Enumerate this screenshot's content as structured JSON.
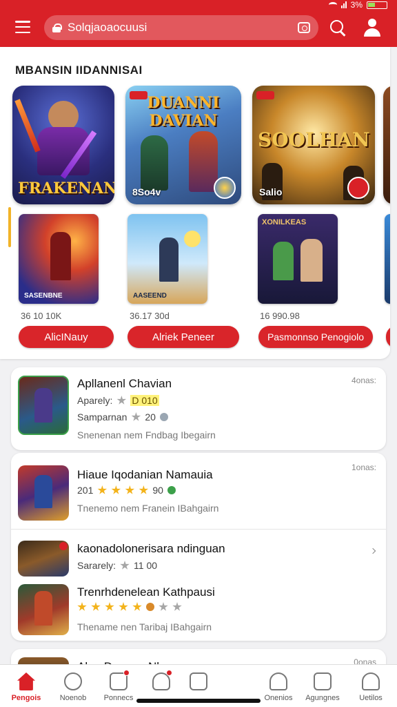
{
  "status": {
    "signal": "3%"
  },
  "header": {
    "search_placeholder": "Solqjaoaocuusi"
  },
  "featured": {
    "title": "MBANSIN IIDANNISAI",
    "big_cards": [
      {
        "title": "FRAKENAN",
        "stat": ""
      },
      {
        "title": "DUANNI DAVIAN",
        "stat": "8So4v"
      },
      {
        "title": "SOOLHAN",
        "stat": "Salio"
      }
    ],
    "small_cards": [
      {
        "label": "SASENBNE",
        "top": "",
        "count": "36 10 10K",
        "button": "AlicINauy"
      },
      {
        "label": "AASEEND",
        "top": "",
        "count": "36.17 30d",
        "button": "Alriek Peneer"
      },
      {
        "label": "",
        "top": "XONILKEAS",
        "count": "16 990.98",
        "button": "Pasmonnso Penogiolo"
      }
    ]
  },
  "list": [
    {
      "title": "Apllanenl Chavian",
      "time": "4onas:",
      "sub_label": "Aparely:",
      "sub_value": "D 010",
      "line2_label": "Samparnan",
      "line2_value": "20",
      "meta": "Snenenan nem Fndbag Ibegairn"
    },
    {
      "title": "Hiaue Iqodanian Namauia",
      "time": "1onas:",
      "sub_label": "201",
      "sub_value": "90",
      "meta": "Tnenemo nem Franein IBahgairn"
    },
    {
      "title": "kaonadolonerisara ndinguan",
      "sub_label": "Sararely:",
      "sub_value": "11 00"
    },
    {
      "title": "Trenrhdenelean Kathpausi",
      "meta": "Thename nen Taribaj IBahgairn"
    },
    {
      "title": "Aluo Douaea Nlau",
      "time": "0onas"
    }
  ],
  "nav": [
    {
      "label": "Pengois"
    },
    {
      "label": "Noenob"
    },
    {
      "label": "Ponnecs"
    },
    {
      "label": ""
    },
    {
      "label": ""
    },
    {
      "label": "Onenios"
    },
    {
      "label": "Agungnes"
    },
    {
      "label": "Uetilos"
    }
  ],
  "colors": {
    "brand": "#d92127",
    "star": "#f3b31b"
  }
}
